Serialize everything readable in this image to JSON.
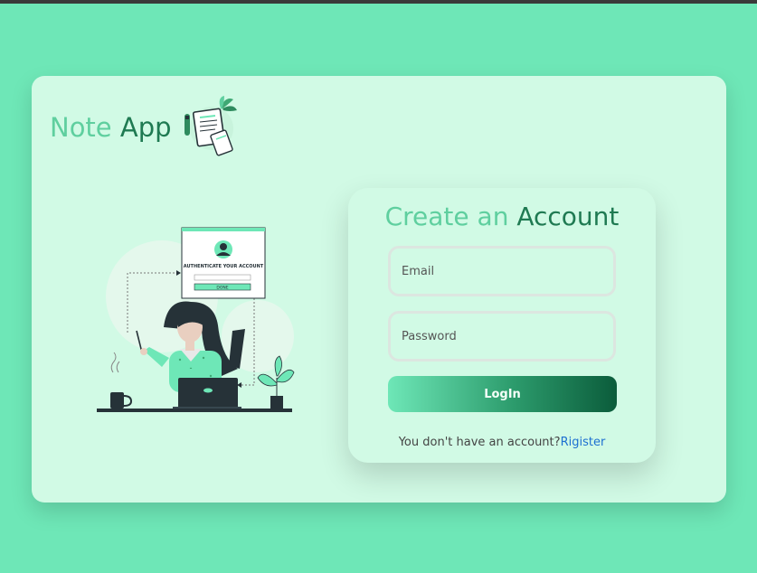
{
  "brand": {
    "title_part1": "Note",
    "title_part2": "App"
  },
  "illustration": {
    "card_caption": "AUTHENTICATE YOUR ACCOUNT",
    "card_button": "DONE"
  },
  "form": {
    "title_part1": "Create an",
    "title_part2": "Account",
    "email_placeholder": "Email",
    "password_placeholder": "Password",
    "login_label": "LogIn",
    "no_account_text": "You don't have an account?",
    "register_label": "Rigister"
  },
  "colors": {
    "background": "#6ee7b7",
    "card": "#d1fae5",
    "accent_light": "#5fcf9f",
    "accent_dark": "#1f7a52",
    "link": "#1d6fd1"
  },
  "icons": [
    "notebook-logo-icon",
    "person-avatar-icon",
    "laptop-icon",
    "coffee-mug-icon",
    "plant-icon"
  ]
}
